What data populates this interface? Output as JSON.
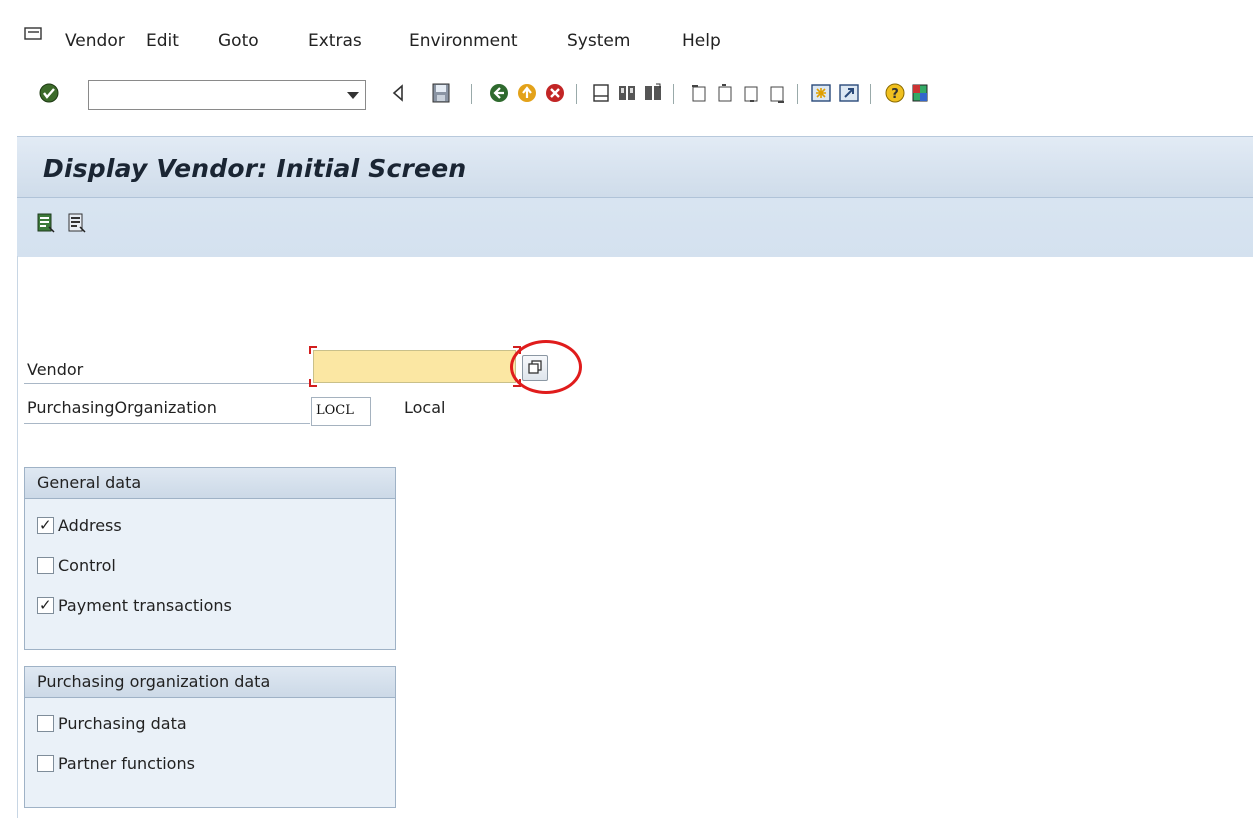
{
  "menubar": {
    "items": [
      {
        "label": "Vendor"
      },
      {
        "label": "Edit"
      },
      {
        "label": "Goto"
      },
      {
        "label": "Extras"
      },
      {
        "label": "Environment"
      },
      {
        "label": "System"
      },
      {
        "label": "Help"
      }
    ]
  },
  "toolbar": {
    "command_field_value": "",
    "icons": [
      "enter-icon",
      "back-arrow-icon",
      "save-icon",
      "back-icon",
      "exit-icon",
      "cancel-icon",
      "print-icon",
      "find-icon",
      "find-next-icon",
      "first-page-icon",
      "previous-page-icon",
      "next-page-icon",
      "last-page-icon",
      "create-session-icon",
      "shortcut-icon",
      "help-icon",
      "customize-layout-icon"
    ]
  },
  "title": {
    "text": "Display Vendor:  Initial Screen"
  },
  "form": {
    "vendor_label": "Vendor",
    "vendor_value": "",
    "porg_label": "PurchasingOrganization",
    "porg_value": "LOCL",
    "porg_description": "Local"
  },
  "general_data": {
    "title": "General data",
    "items": [
      {
        "label": "Address",
        "checked": true
      },
      {
        "label": "Control",
        "checked": false
      },
      {
        "label": "Payment transactions",
        "checked": true
      }
    ]
  },
  "purchasing_data": {
    "title": "Purchasing organization data",
    "items": [
      {
        "label": "Purchasing data",
        "checked": false
      },
      {
        "label": "Partner functions",
        "checked": false
      }
    ]
  },
  "colors": {
    "required_input_bg": "#fbe7a3",
    "highlight_ring": "#e01c1c",
    "title_band": "#d4e1ef"
  }
}
